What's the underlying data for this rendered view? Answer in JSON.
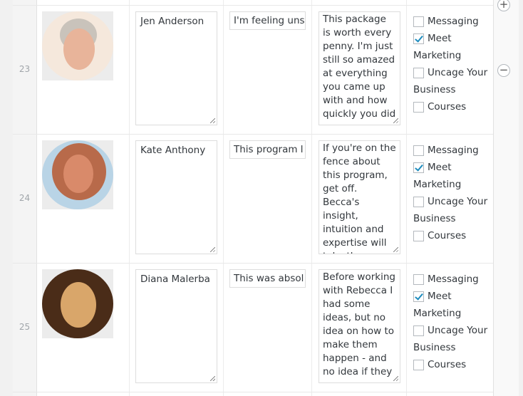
{
  "rows": [
    {
      "order": "23",
      "name": "Jen Anderson",
      "headline": "I'm feeling uns",
      "text": "This package is worth every penny. I'm just still so amazed at everything you came up with and how quickly you did",
      "avatar_colors": {
        "bg": "#f5e8dc",
        "face": "#e8b49a",
        "hair": "#c9c3bb"
      },
      "products": [
        {
          "label": "Messaging",
          "checked": false
        },
        {
          "label": "Meet",
          "cont": "Marketing",
          "checked": true
        },
        {
          "label": "Uncage Your",
          "cont": "Business",
          "checked": false
        },
        {
          "label": "Courses",
          "checked": false
        }
      ]
    },
    {
      "order": "24",
      "name": "Kate Anthony",
      "headline": "This program l",
      "text": "If you're on the fence about this program, get off. Becca's insight, intuition and expertise will take the",
      "avatar_colors": {
        "bg": "#b9d4e6",
        "face": "#d98a6a",
        "hair": "#b86a4a"
      },
      "products": [
        {
          "label": "Messaging",
          "checked": false
        },
        {
          "label": "Meet",
          "cont": "Marketing",
          "checked": true
        },
        {
          "label": "Uncage Your",
          "cont": "Business",
          "checked": false
        },
        {
          "label": "Courses",
          "checked": false
        }
      ]
    },
    {
      "order": "25",
      "name": "Diana Malerba",
      "headline": "This was absol",
      "text": "Before working with Rebecca I had some ideas, but no idea on how to make them happen - and no idea if they",
      "avatar_colors": {
        "bg": "#5a3a22",
        "face": "#d9a66a",
        "hair": "#4a2c18"
      },
      "products": [
        {
          "label": "Messaging",
          "checked": false
        },
        {
          "label": "Meet",
          "cont": "Marketing",
          "checked": true
        },
        {
          "label": "Uncage Your",
          "cont": "Business",
          "checked": false
        },
        {
          "label": "Courses",
          "checked": false
        }
      ]
    }
  ],
  "actions": {
    "add_icon": "plus-circle-icon",
    "add_symbol": "+",
    "remove_icon": "minus-circle-icon",
    "remove_symbol": "−"
  }
}
